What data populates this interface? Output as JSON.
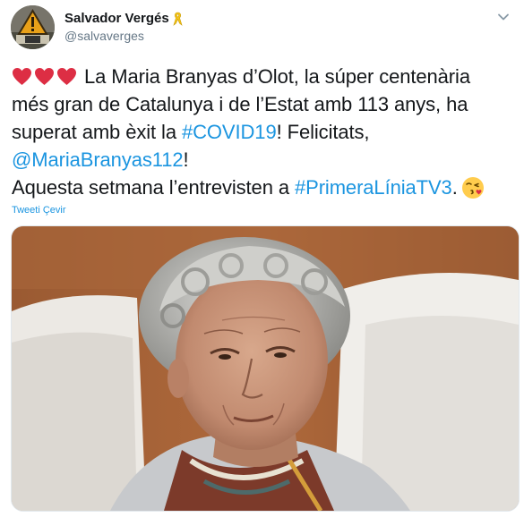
{
  "author": {
    "name": "Salvador Vergés",
    "handle": "@salvaverges",
    "badge_icon": "yellow-ribbon-icon"
  },
  "tweet": {
    "lines": [
      {
        "hearts": 3,
        "text": "La Maria Branyas d’Olot, la súper centenària"
      },
      {
        "text": "més gran de Catalunya i de l’Estat amb 113 anys, ha"
      },
      {
        "pre": "superat amb èxit la ",
        "hashtag": "#COVID19",
        "post": "! Felicitats,"
      },
      {
        "mention": "@MariaBranyas112",
        "post": "!"
      },
      {
        "pre": "Aquesta setmana l’entrevisten a ",
        "hashtag": "#PrimeraLíniaTV3",
        "post": ".",
        "emoji": "face-blowing-kiss-icon"
      }
    ],
    "translate_label": "Tweeti Çevir"
  },
  "media": {
    "alt": "Photo of an elderly woman with curled grey hair, wearing a patterned scarf"
  },
  "colors": {
    "link": "#1b95e0",
    "text": "#14171a",
    "secondary": "#657786",
    "heart": "#e0245e"
  }
}
